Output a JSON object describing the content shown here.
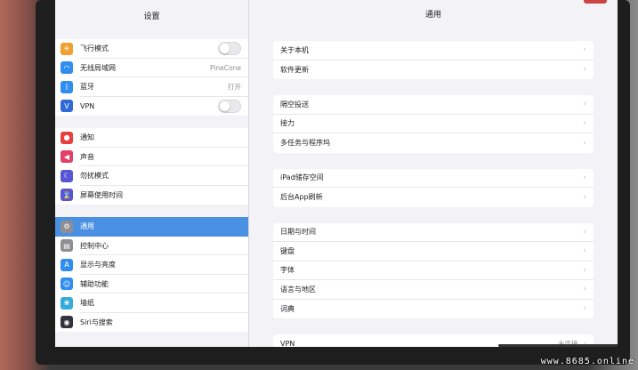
{
  "sidebar": {
    "title": "设置",
    "groups": [
      [
        {
          "label": "飞行模式",
          "icon": "airplane-icon",
          "color": "#f0a030",
          "control": "toggle"
        },
        {
          "label": "无线局域网",
          "icon": "wifi-icon",
          "color": "#2f8ef0",
          "value": "PineCone"
        },
        {
          "label": "蓝牙",
          "icon": "bluetooth-icon",
          "color": "#2f8ef0",
          "value": "打开"
        },
        {
          "label": "VPN",
          "icon": "vpn-icon",
          "color": "#2f6ad8",
          "control": "toggle"
        }
      ],
      [
        {
          "label": "通知",
          "icon": "notifications-icon",
          "color": "#e84040"
        },
        {
          "label": "声音",
          "icon": "sound-icon",
          "color": "#e0406a"
        },
        {
          "label": "勿扰模式",
          "icon": "moon-icon",
          "color": "#5856d6"
        },
        {
          "label": "屏幕使用时间",
          "icon": "hourglass-icon",
          "color": "#5856d6"
        }
      ],
      [
        {
          "label": "通用",
          "icon": "gear-icon",
          "color": "#8e8e93",
          "active": true
        },
        {
          "label": "控制中心",
          "icon": "control-center-icon",
          "color": "#8e8e93"
        },
        {
          "label": "显示与亮度",
          "icon": "display-icon",
          "color": "#2f8ef0"
        },
        {
          "label": "辅助功能",
          "icon": "accessibility-icon",
          "color": "#2f8ef0"
        },
        {
          "label": "墙纸",
          "icon": "wallpaper-icon",
          "color": "#36aadc"
        },
        {
          "label": "Siri与搜索",
          "icon": "siri-icon",
          "color": "#333340"
        }
      ]
    ]
  },
  "main": {
    "title": "通用",
    "groups": [
      [
        {
          "label": "关于本机"
        },
        {
          "label": "软件更新"
        }
      ],
      [
        {
          "label": "隔空投送"
        },
        {
          "label": "接力"
        },
        {
          "label": "多任务与程序坞"
        }
      ],
      [
        {
          "label": "iPad储存空间"
        },
        {
          "label": "后台App刷新"
        }
      ],
      [
        {
          "label": "日期与时间"
        },
        {
          "label": "键盘"
        },
        {
          "label": "字体"
        },
        {
          "label": "语言与地区"
        },
        {
          "label": "词典"
        }
      ],
      [
        {
          "label": "VPN",
          "value": "未连接"
        }
      ]
    ]
  },
  "watermark": "www.8685.online"
}
